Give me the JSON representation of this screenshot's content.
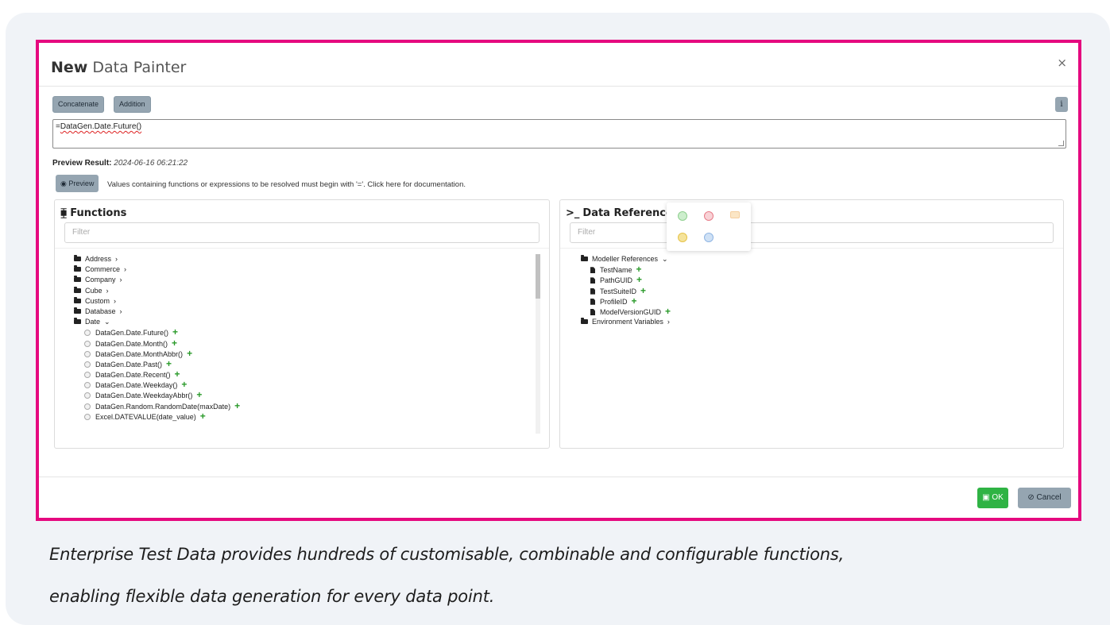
{
  "modal": {
    "title_bold": "New",
    "title_rest": "Data Painter",
    "close_label": "×"
  },
  "toolbar": {
    "concatenate_label": "Concatenate",
    "addition_label": "Addition",
    "info_label": "i"
  },
  "expression": {
    "prefix": "=",
    "value": "DataGen.Date.Future()"
  },
  "preview": {
    "result_label": "Preview Result:",
    "result_value": "2024-06-16 06:21:22",
    "button_label": "Preview",
    "note": "Values containing functions or expressions to be resolved must begin with '='. Click here for documentation."
  },
  "functions_panel": {
    "title": "Functions",
    "filter_placeholder": "Filter",
    "folders": [
      {
        "label": "Address",
        "expanded": false
      },
      {
        "label": "Commerce",
        "expanded": false
      },
      {
        "label": "Company",
        "expanded": false
      },
      {
        "label": "Cube",
        "expanded": false
      },
      {
        "label": "Custom",
        "expanded": false
      },
      {
        "label": "Database",
        "expanded": false
      },
      {
        "label": "Date",
        "expanded": true
      }
    ],
    "date_functions": [
      "DataGen.Date.Future()",
      "DataGen.Date.Month()",
      "DataGen.Date.MonthAbbr()",
      "DataGen.Date.Past()",
      "DataGen.Date.Recent()",
      "DataGen.Date.Weekday()",
      "DataGen.Date.WeekdayAbbr()",
      "DataGen.Random.RandomDate(maxDate)",
      "Excel.DATEVALUE(date_value)"
    ]
  },
  "references_panel": {
    "title": "Data References",
    "filter_placeholder": "Filter",
    "modeller_folder": "Modeller References",
    "modeller_items": [
      "TestName",
      "PathGUID",
      "TestSuiteID",
      "ProfileID",
      "ModelVersionGUID"
    ],
    "env_folder": "Environment Variables"
  },
  "color_swatches": [
    "#cdeecd",
    "#f8d2d6",
    "#fbe6c6",
    "#f5e39a",
    "#cfe1f5"
  ],
  "footer": {
    "ok_label": "OK",
    "cancel_label": "Cancel"
  },
  "caption": {
    "line1": "Enterprise Test Data provides hundreds of customisable, combinable and configurable functions,",
    "line2": "enabling flexible data generation for every data point."
  }
}
